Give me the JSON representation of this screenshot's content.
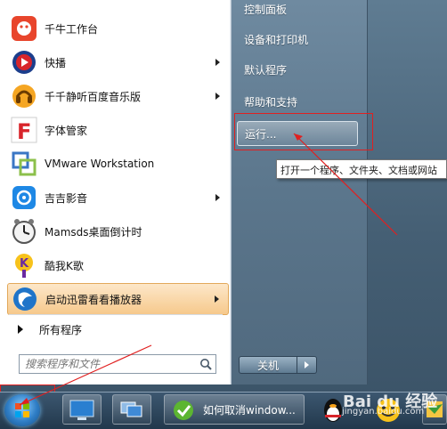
{
  "start_menu": {
    "programs": [
      {
        "label": "千牛工作台",
        "icon": "qianniu-icon",
        "submenu": false
      },
      {
        "label": "快播",
        "icon": "qvod-icon",
        "submenu": true
      },
      {
        "label": "千千静听百度音乐版",
        "icon": "ttplayer-icon",
        "submenu": true
      },
      {
        "label": "字体管家",
        "icon": "font-manager-icon",
        "submenu": false
      },
      {
        "label": "VMware Workstation",
        "icon": "vmware-icon",
        "submenu": false
      },
      {
        "label": "吉吉影音",
        "icon": "jijiyingyin-icon",
        "submenu": true
      },
      {
        "label": "Mamsds桌面倒计时",
        "icon": "clock-icon",
        "submenu": false
      },
      {
        "label": "酷我K歌",
        "icon": "kuwo-ksong-icon",
        "submenu": false
      },
      {
        "label": "启动迅雷看看播放器",
        "icon": "xunlei-player-icon",
        "submenu": true
      }
    ],
    "all_programs": "所有程序",
    "search": {
      "placeholder": "搜索程序和文件"
    },
    "right_items": [
      "控制面板",
      "设备和打印机",
      "默认程序",
      "帮助和支持",
      "运行..."
    ],
    "shutdown": "关机",
    "tooltip": "打开一个程序、文件夹、文档或网站"
  },
  "taskbar": {
    "active_task": "如何取消window...",
    "watermark": "Bai du 经验",
    "watermark_sub": "jingyan.baidu.com"
  },
  "colors": {
    "highlight": "#f6c98c",
    "annotation": "#e02020"
  }
}
